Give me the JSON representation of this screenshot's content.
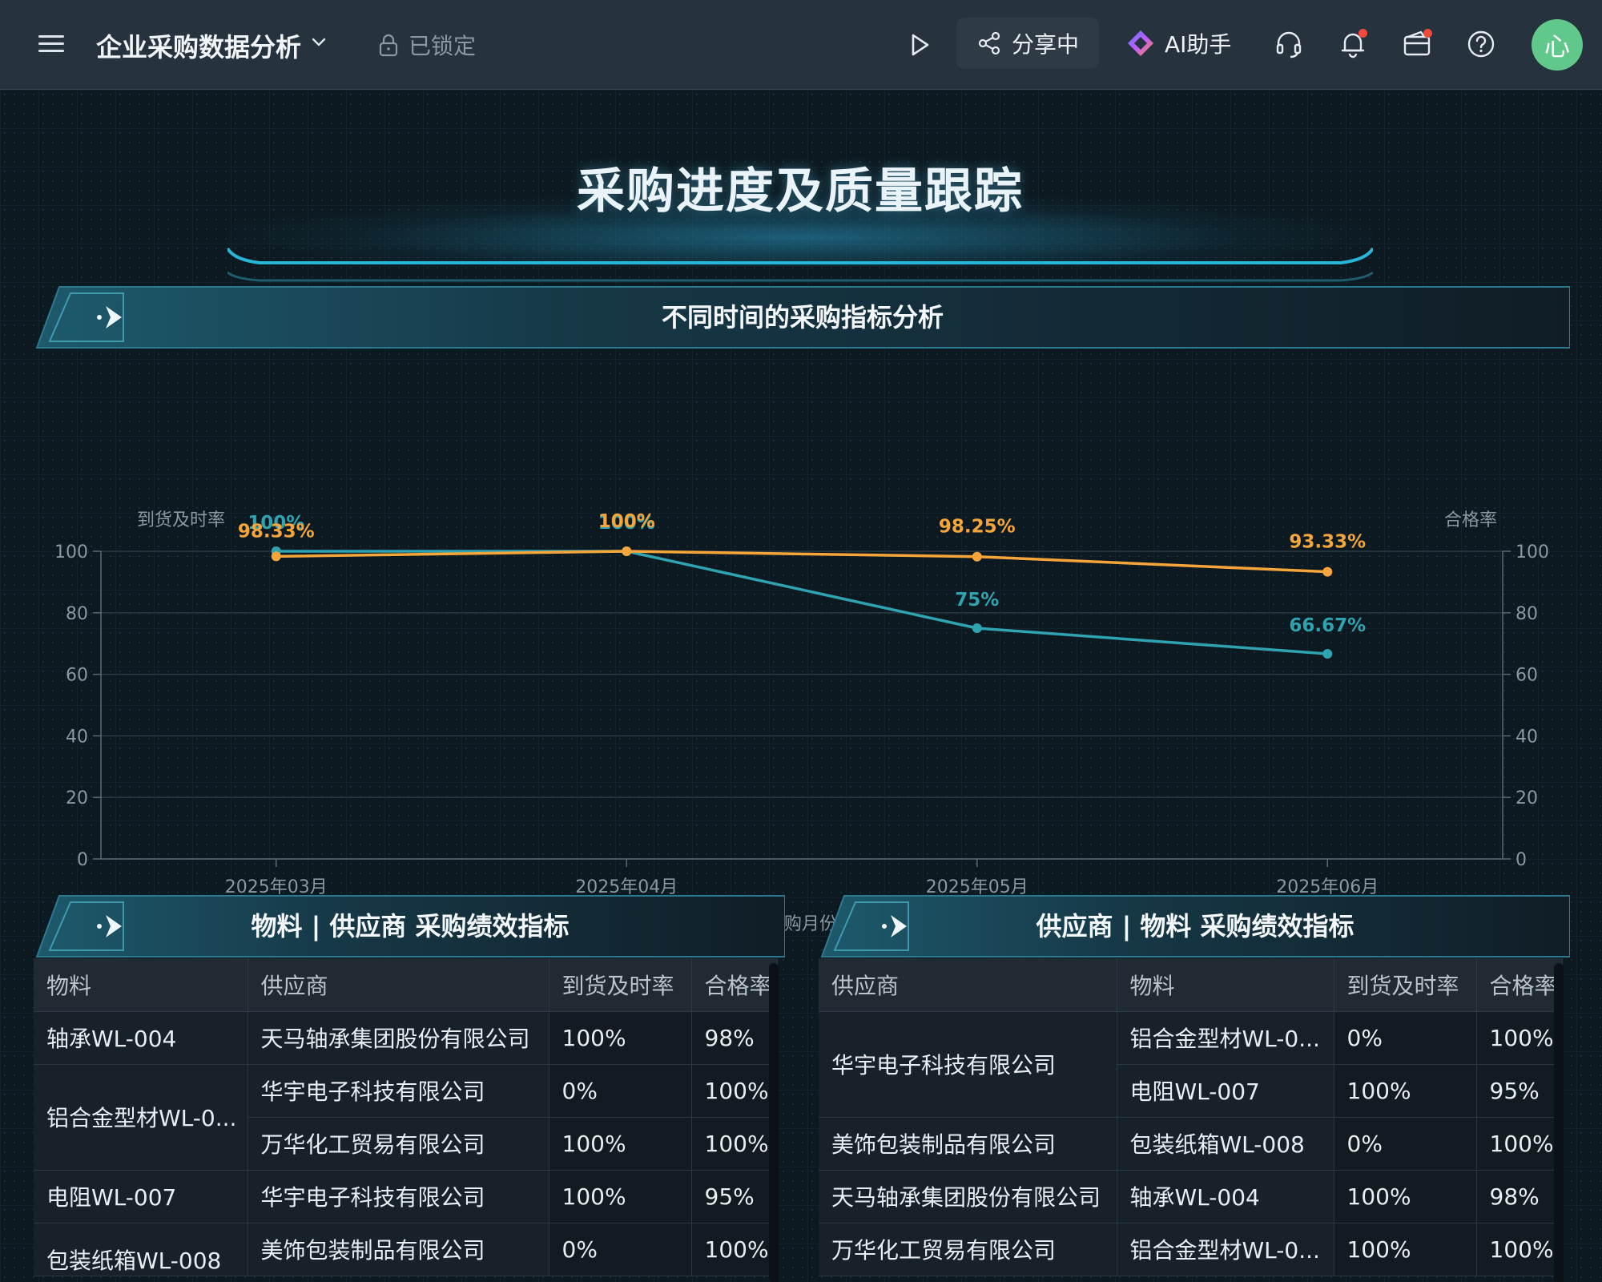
{
  "header": {
    "app_title": "企业采购数据分析",
    "lock_label": "已锁定",
    "share_label": "分享中",
    "ai_label": "AI助手",
    "avatar_text": "心"
  },
  "colors": {
    "accent_teal": "#2fa3b0",
    "accent_orange": "#f5a53a",
    "avatar_green": "#5fc88a",
    "notification_red": "#f24a3a"
  },
  "icons": [
    "menu-icon",
    "chevron-down-icon",
    "lock-icon",
    "play-icon",
    "share-icon",
    "ai-logo-icon",
    "headset-icon",
    "bell-icon",
    "wallet-icon",
    "help-icon",
    "arrow-right-icon"
  ],
  "hero": {
    "title": "采购进度及质量跟踪"
  },
  "section_chart": {
    "title": "不同时间的采购指标分析"
  },
  "chart_data": {
    "type": "line",
    "categories": [
      "2025年03月",
      "2025年04月",
      "2025年05月",
      "2025年06月"
    ],
    "series": [
      {
        "name": "到货及时率",
        "values": [
          100,
          100,
          75,
          66.67
        ],
        "labels": [
          "100%",
          "100%",
          "75%",
          "66.67%"
        ],
        "color": "#2fa3b0",
        "axis": "left"
      },
      {
        "name": "合格率",
        "values": [
          98.33,
          100,
          98.25,
          93.33
        ],
        "labels": [
          "98.33%",
          "100%",
          "98.25%",
          "93.33%"
        ],
        "color": "#f5a53a",
        "axis": "right"
      }
    ],
    "ylabel_left": "到货及时率",
    "ylabel_right": "合格率",
    "xlabel": "采购月份",
    "ylim": [
      0,
      100
    ],
    "yticks": [
      "0",
      "20",
      "40",
      "60",
      "80",
      "100"
    ],
    "grid": true
  },
  "table_left": {
    "title": "物料 | 供应商 采购绩效指标",
    "columns": [
      "物料",
      "供应商",
      "到货及时率",
      "合格率"
    ],
    "rows": [
      {
        "material": "轴承WL-004",
        "supplier": "天马轴承集团股份有限公司",
        "ontime": "100%",
        "quality": "98%"
      },
      {
        "material": "铝合金型材WL-0...",
        "supplier": "华宇电子科技有限公司",
        "ontime": "0%",
        "quality": "100%"
      },
      {
        "material": "",
        "supplier": "万华化工贸易有限公司",
        "ontime": "100%",
        "quality": "100%"
      },
      {
        "material": "电阻WL-007",
        "supplier": "华宇电子科技有限公司",
        "ontime": "100%",
        "quality": "95%"
      },
      {
        "material": "包装纸箱WL-008",
        "supplier": "美饰包装制品有限公司",
        "ontime": "0%",
        "quality": "100%"
      }
    ]
  },
  "table_right": {
    "title": "供应商 | 物料 采购绩效指标",
    "columns": [
      "供应商",
      "物料",
      "到货及时率",
      "合格率"
    ],
    "rows": [
      {
        "supplier": "华宇电子科技有限公司",
        "material": "铝合金型材WL-0...",
        "ontime": "0%",
        "quality": "100%"
      },
      {
        "supplier": "",
        "material": "电阻WL-007",
        "ontime": "100%",
        "quality": "95%"
      },
      {
        "supplier": "美饰包装制品有限公司",
        "material": "包装纸箱WL-008",
        "ontime": "0%",
        "quality": "100%"
      },
      {
        "supplier": "天马轴承集团股份有限公司",
        "material": "轴承WL-004",
        "ontime": "100%",
        "quality": "98%"
      },
      {
        "supplier": "万华化工贸易有限公司",
        "material": "铝合金型材WL-0...",
        "ontime": "100%",
        "quality": "100%"
      }
    ]
  }
}
